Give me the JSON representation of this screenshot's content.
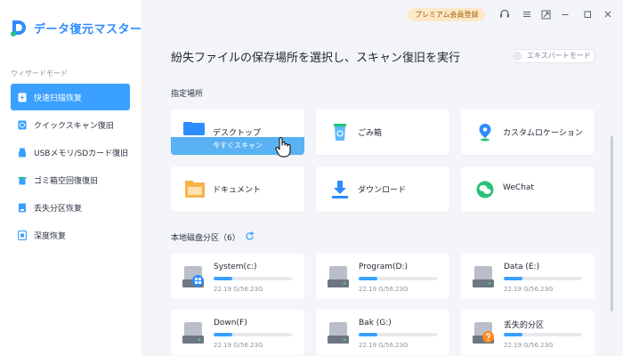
{
  "app": {
    "name": "データ復元マスター"
  },
  "sidebar": {
    "section_label": "ウィザードモード",
    "items": [
      {
        "label": "快速扫描恢复",
        "icon": "bolt-icon",
        "active": true
      },
      {
        "label": "クイックスキャン復旧",
        "icon": "clock-icon",
        "active": false
      },
      {
        "label": "USBメモリ/SDカード復旧",
        "icon": "usb-icon",
        "active": false
      },
      {
        "label": "ゴミ箱空回復復旧",
        "icon": "trash-icon",
        "active": false
      },
      {
        "label": "丢失分区恢复",
        "icon": "partition-icon",
        "active": false
      },
      {
        "label": "深度恢复",
        "icon": "deep-scan-icon",
        "active": false
      }
    ]
  },
  "titlebar": {
    "premium_label": "プレミアム会員登録"
  },
  "main": {
    "heading": "紛失ファイルの保存場所を選択し、スキャン復旧を実行",
    "expert_mode_label": "エキスパートモード",
    "specified_label": "指定場所",
    "locations": [
      {
        "label": "デスクトップ",
        "icon": "desktop-folder-icon",
        "scan_label": "今すぐスキャン"
      },
      {
        "label": "ごみ箱",
        "icon": "recycle-bin-icon"
      },
      {
        "label": "カスタムロケーション",
        "icon": "location-pin-icon"
      },
      {
        "label": "ドキュメント",
        "icon": "documents-folder-icon"
      },
      {
        "label": "ダウンロード",
        "icon": "download-icon"
      },
      {
        "label": "WeChat",
        "icon": "wechat-icon"
      }
    ],
    "disks_label": "本地磁盘分区（6）",
    "disks": [
      {
        "name": "System(c:)",
        "size": "22.19 G/56.23G",
        "used": 0.24,
        "badge": "windows"
      },
      {
        "name": "Program(D:)",
        "size": "22.19 G/56.23G",
        "used": 0.24
      },
      {
        "name": "Data (E:)",
        "size": "22.19 G/56.23G",
        "used": 0.24
      },
      {
        "name": "Down(F)",
        "size": "22.19 G/56.23G",
        "used": 0.24
      },
      {
        "name": "Bak (G:)",
        "size": "22.19 G/56.23G",
        "used": 0.24
      },
      {
        "name": "丢失的分区",
        "size": "22.19 G/56.23G",
        "used": 0.24,
        "badge": "question"
      }
    ]
  },
  "colors": {
    "accent": "#3aa0ff",
    "premium_bg": "#fde9c8",
    "premium_text": "#a05a00"
  }
}
